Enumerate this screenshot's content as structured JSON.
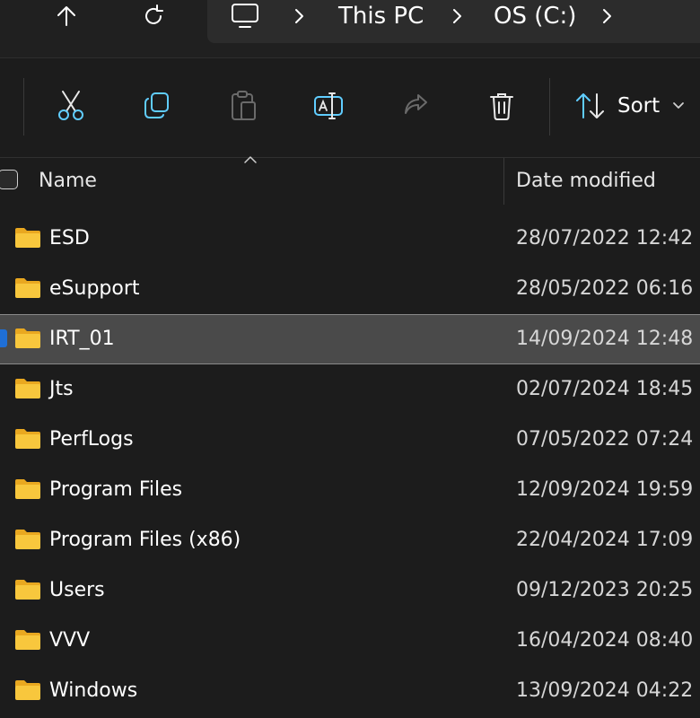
{
  "nav": {
    "up_icon": "arrow-up-icon",
    "refresh_icon": "refresh-icon"
  },
  "breadcrumb": {
    "root_icon": "monitor-icon",
    "items": [
      "This PC",
      "OS (C:)"
    ]
  },
  "toolbar": {
    "buttons": [
      "cut-icon",
      "copy-icon",
      "paste-icon",
      "rename-icon",
      "share-icon",
      "delete-icon"
    ],
    "sort_label": "Sort"
  },
  "columns": {
    "name": "Name",
    "date_modified": "Date modified"
  },
  "files": [
    {
      "name": "ESD",
      "date": "28/07/2022 12:42",
      "selected": false
    },
    {
      "name": "eSupport",
      "date": "28/05/2022 06:16",
      "selected": false
    },
    {
      "name": "IRT_01",
      "date": "14/09/2024 12:48",
      "selected": true
    },
    {
      "name": "Jts",
      "date": "02/07/2024 18:45",
      "selected": false
    },
    {
      "name": "PerfLogs",
      "date": "07/05/2022 07:24",
      "selected": false
    },
    {
      "name": "Program Files",
      "date": "12/09/2024 19:59",
      "selected": false
    },
    {
      "name": "Program Files (x86)",
      "date": "22/04/2024 17:09",
      "selected": false
    },
    {
      "name": "Users",
      "date": "09/12/2023 20:25",
      "selected": false
    },
    {
      "name": "VVV",
      "date": "16/04/2024 08:40",
      "selected": false
    },
    {
      "name": "Windows",
      "date": "13/09/2024 04:22",
      "selected": false
    }
  ],
  "colors": {
    "background": "#1c1c1c",
    "selection": "#4a4a4a",
    "accent": "#60cdff",
    "folder": "#f8c73d"
  }
}
